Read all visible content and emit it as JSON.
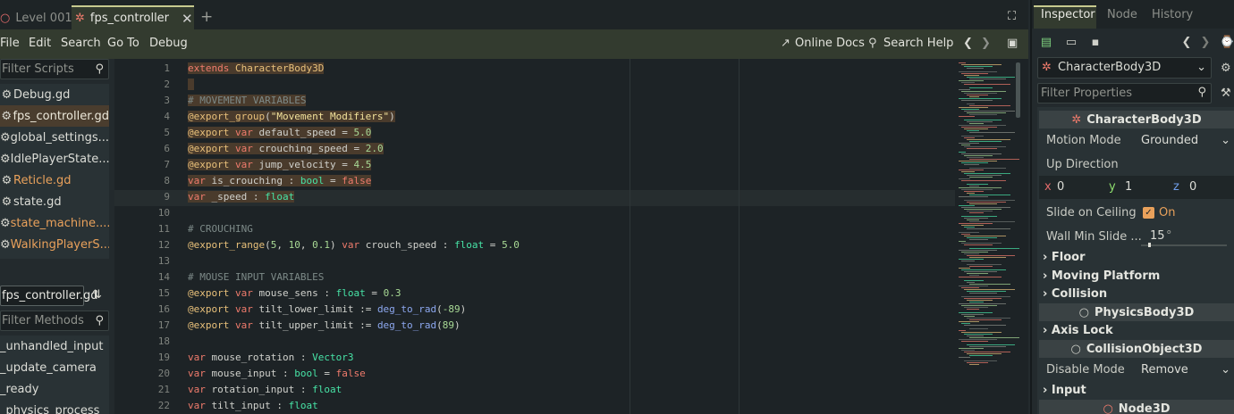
{
  "tabs": [
    {
      "label": "Level 001"
    },
    {
      "label": "fps_controller"
    }
  ],
  "menu": {
    "file": "File",
    "edit": "Edit",
    "search": "Search",
    "goto": "Go To",
    "debug": "Debug",
    "online_docs": "Online Docs",
    "search_help": "Search Help"
  },
  "scripts": {
    "filter_placeholder": "Filter Scripts",
    "items": [
      {
        "label": "Debug.gd"
      },
      {
        "label": "fps_controller.gd"
      },
      {
        "label": "global_settings...."
      },
      {
        "label": "IdlePlayerState...."
      },
      {
        "label": "Reticle.gd"
      },
      {
        "label": "state.gd"
      },
      {
        "label": "state_machine...."
      },
      {
        "label": "WalkingPlayerS..."
      }
    ]
  },
  "methods": {
    "current_file": "fps_controller.gd",
    "filter_placeholder": "Filter Methods",
    "items": [
      {
        "label": "_unhandled_input"
      },
      {
        "label": "_update_camera"
      },
      {
        "label": "_ready"
      },
      {
        "label": "_physics_process"
      }
    ]
  },
  "code": {
    "line_numbers": [
      "1",
      "2",
      "3",
      "4",
      "5",
      "6",
      "7",
      "8",
      "9",
      "10",
      "11",
      "12",
      "13",
      "14",
      "15",
      "16",
      "17",
      "18",
      "19",
      "20",
      "21",
      "22"
    ],
    "lines": [
      [
        {
          "t": "extends",
          "c": "kw"
        },
        {
          "t": " CharacterBody3D",
          "c": "ty2"
        }
      ],
      [],
      [
        {
          "t": "# MOVEMENT VARIABLES",
          "c": "cm"
        }
      ],
      [
        {
          "t": "@export_group",
          "c": "an"
        },
        {
          "t": "(",
          "c": ""
        },
        {
          "t": "\"Movement Modifiers\"",
          "c": "str"
        },
        {
          "t": ")",
          "c": ""
        }
      ],
      [
        {
          "t": "@export",
          "c": "an"
        },
        {
          "t": " var",
          "c": "kw"
        },
        {
          "t": " default_speed = ",
          "c": ""
        },
        {
          "t": "5.0",
          "c": "nm"
        }
      ],
      [
        {
          "t": "@export",
          "c": "an"
        },
        {
          "t": " var",
          "c": "kw"
        },
        {
          "t": " crouching_speed = ",
          "c": ""
        },
        {
          "t": "2.0",
          "c": "nm"
        }
      ],
      [
        {
          "t": "@export",
          "c": "an"
        },
        {
          "t": " var",
          "c": "kw"
        },
        {
          "t": " jump_velocity = ",
          "c": ""
        },
        {
          "t": "4.5",
          "c": "nm"
        }
      ],
      [
        {
          "t": "var",
          "c": "kw"
        },
        {
          "t": " is_crouching : ",
          "c": ""
        },
        {
          "t": "bool",
          "c": "ty"
        },
        {
          "t": " = ",
          "c": ""
        },
        {
          "t": "false",
          "c": "kw"
        }
      ],
      [
        {
          "t": "var",
          "c": "kw"
        },
        {
          "t": " _speed : ",
          "c": ""
        },
        {
          "t": "float",
          "c": "ty"
        }
      ],
      [],
      [
        {
          "t": "# CROUCHING",
          "c": "cm"
        }
      ],
      [
        {
          "t": "@export_range",
          "c": "an"
        },
        {
          "t": "(",
          "c": ""
        },
        {
          "t": "5",
          "c": "nm"
        },
        {
          "t": ", ",
          "c": ""
        },
        {
          "t": "10",
          "c": "nm"
        },
        {
          "t": ", ",
          "c": ""
        },
        {
          "t": "0.1",
          "c": "nm"
        },
        {
          "t": ")",
          "c": ""
        },
        {
          "t": " var",
          "c": "kw"
        },
        {
          "t": " crouch_speed : ",
          "c": ""
        },
        {
          "t": "float",
          "c": "ty"
        },
        {
          "t": " = ",
          "c": ""
        },
        {
          "t": "5.0",
          "c": "nm"
        }
      ],
      [],
      [
        {
          "t": "# MOUSE INPUT VARIABLES",
          "c": "cm"
        }
      ],
      [
        {
          "t": "@export",
          "c": "an"
        },
        {
          "t": " var",
          "c": "kw"
        },
        {
          "t": " mouse_sens : ",
          "c": ""
        },
        {
          "t": "float",
          "c": "ty"
        },
        {
          "t": " = ",
          "c": ""
        },
        {
          "t": "0.3",
          "c": "nm"
        }
      ],
      [
        {
          "t": "@export",
          "c": "an"
        },
        {
          "t": " var",
          "c": "kw"
        },
        {
          "t": " tilt_lower_limit := ",
          "c": ""
        },
        {
          "t": "deg_to_rad",
          "c": "fn"
        },
        {
          "t": "(",
          "c": ""
        },
        {
          "t": "-89",
          "c": "nm"
        },
        {
          "t": ")",
          "c": ""
        }
      ],
      [
        {
          "t": "@export",
          "c": "an"
        },
        {
          "t": " var",
          "c": "kw"
        },
        {
          "t": " tilt_upper_limit := ",
          "c": ""
        },
        {
          "t": "deg_to_rad",
          "c": "fn"
        },
        {
          "t": "(",
          "c": ""
        },
        {
          "t": "89",
          "c": "nm"
        },
        {
          "t": ")",
          "c": ""
        }
      ],
      [],
      [
        {
          "t": "var",
          "c": "kw"
        },
        {
          "t": " mouse_rotation : ",
          "c": ""
        },
        {
          "t": "Vector3",
          "c": "ty"
        }
      ],
      [
        {
          "t": "var",
          "c": "kw"
        },
        {
          "t": " mouse_input : ",
          "c": ""
        },
        {
          "t": "bool",
          "c": "ty"
        },
        {
          "t": " = ",
          "c": ""
        },
        {
          "t": "false",
          "c": "kw"
        }
      ],
      [
        {
          "t": "var",
          "c": "kw"
        },
        {
          "t": " rotation_input : ",
          "c": ""
        },
        {
          "t": "float",
          "c": "ty"
        }
      ],
      [
        {
          "t": "var",
          "c": "kw"
        },
        {
          "t": " tilt_input : ",
          "c": ""
        },
        {
          "t": "float",
          "c": "ty"
        }
      ]
    ]
  },
  "dock": {
    "tab_inspector": "Inspector",
    "tab_node": "Node",
    "tab_history": "History",
    "node_selector": "CharacterBody3D",
    "filter_placeholder": "Filter Properties",
    "section_characterbody": "CharacterBody3D",
    "motion_mode_label": "Motion Mode",
    "motion_mode_value": "Grounded",
    "up_direction_label": "Up Direction",
    "x_label": "x",
    "x_value": "0",
    "y_label": "y",
    "y_value": "1",
    "z_label": "z",
    "z_value": "0",
    "slide_ceiling_label": "Slide on Ceiling",
    "slide_ceiling_value": "On",
    "wall_min_label": "Wall Min Slide ...",
    "wall_min_value": "15",
    "wall_min_unit": "°",
    "cat_floor": "Floor",
    "cat_moving_platform": "Moving Platform",
    "cat_collision": "Collision",
    "section_physicsbody": "PhysicsBody3D",
    "cat_axis_lock": "Axis Lock",
    "section_collisionobject": "CollisionObject3D",
    "disable_mode_label": "Disable Mode",
    "disable_mode_value": "Remove",
    "cat_input": "Input",
    "section_node3d": "Node3D"
  },
  "colors": {
    "accent": "#c7c98e",
    "keyword": "#ef7b6c",
    "annotation": "#e8c07a",
    "type": "#47e3a6",
    "number": "#a8d995",
    "comment": "#7d8a88",
    "function": "#8da8f0",
    "string": "#f2e29b"
  }
}
